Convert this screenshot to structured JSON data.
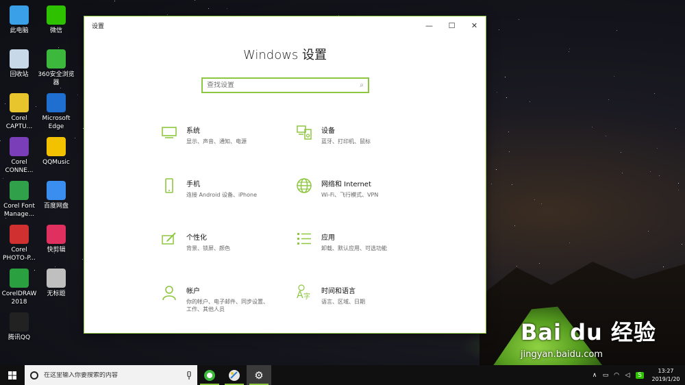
{
  "desktop": {
    "icons": [
      {
        "label": "此电脑",
        "icon": "computer-icon",
        "color": "#3aa0e8"
      },
      {
        "label": "微信",
        "icon": "wechat-icon",
        "color": "#2dc100"
      },
      {
        "label": "回收站",
        "icon": "recycle-bin-icon",
        "color": "#c7d8e8"
      },
      {
        "label": "360安全浏览器",
        "icon": "360-browser-icon",
        "color": "#3cb83c"
      },
      {
        "label": "Corel CAPTU...",
        "icon": "corel-capture-icon",
        "color": "#e8c52d"
      },
      {
        "label": "Microsoft Edge",
        "icon": "edge-icon",
        "color": "#1e6fd0"
      },
      {
        "label": "Corel CONNE...",
        "icon": "corel-connect-icon",
        "color": "#7a3fb8"
      },
      {
        "label": "QQMusic",
        "icon": "qqmusic-icon",
        "color": "#f2c200"
      },
      {
        "label": "Corel Font Manage...",
        "icon": "corel-font-icon",
        "color": "#30a04a"
      },
      {
        "label": "百度网盘",
        "icon": "baidu-netdisk-icon",
        "color": "#3a8ef0"
      },
      {
        "label": "Corel PHOTO-P...",
        "icon": "corel-photo-icon",
        "color": "#d03030"
      },
      {
        "label": "快剪辑",
        "icon": "kuaijianji-icon",
        "color": "#e03060"
      },
      {
        "label": "CorelDRAW 2018",
        "icon": "coreldraw-icon",
        "color": "#2aa040"
      },
      {
        "label": "无标题",
        "icon": "untitled-icon",
        "color": "#bfbfbf"
      },
      {
        "label": "腾讯QQ",
        "icon": "qq-icon",
        "color": "#222222"
      }
    ]
  },
  "window": {
    "title": "设置",
    "minimize": "—",
    "maximize": "☐",
    "close": "✕",
    "heading": "Windows 设置",
    "search_placeholder": "查找设置",
    "accent": "#8dc63f"
  },
  "settings": [
    {
      "name": "系统",
      "desc": "显示、声音、通知、电源",
      "icon": "monitor-icon"
    },
    {
      "name": "设备",
      "desc": "蓝牙、打印机、鼠标",
      "icon": "devices-icon"
    },
    {
      "name": "手机",
      "desc": "连接 Android 设备、iPhone",
      "icon": "phone-icon"
    },
    {
      "name": "网络和 Internet",
      "desc": "Wi-Fi、飞行模式、VPN",
      "icon": "globe-icon"
    },
    {
      "name": "个性化",
      "desc": "背景、锁屏、颜色",
      "icon": "personalization-icon"
    },
    {
      "name": "应用",
      "desc": "卸载、默认应用、可选功能",
      "icon": "apps-list-icon"
    },
    {
      "name": "帐户",
      "desc": "你的帐户、电子邮件、同步设置、工作、其他人员",
      "icon": "user-icon"
    },
    {
      "name": "时间和语言",
      "desc": "语言、区域、日期",
      "icon": "time-language-icon"
    }
  ],
  "taskbar": {
    "search_placeholder": "在这里输入你要搜索的内容",
    "time": "13:27",
    "date": "2019/1/20",
    "tray_ime": "S"
  },
  "watermark": {
    "logo": "Bai du 经验",
    "url": "jingyan.baidu.com"
  }
}
